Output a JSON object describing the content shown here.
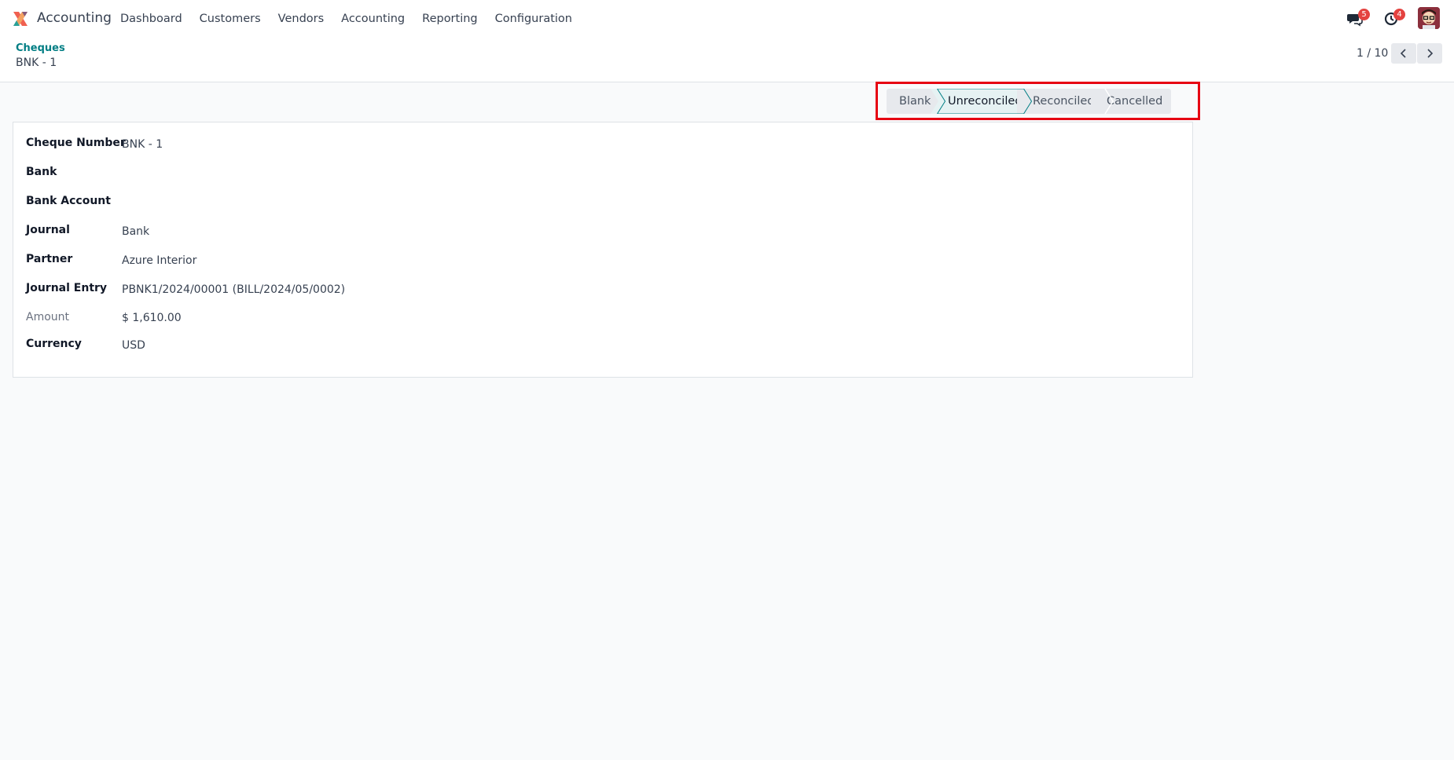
{
  "navbar": {
    "app_name": "Accounting",
    "menu": [
      "Dashboard",
      "Customers",
      "Vendors",
      "Accounting",
      "Reporting",
      "Configuration"
    ],
    "messages_count": "5",
    "activities_count": "4",
    "logo_icon": "odoo-accounting-logo",
    "badge_color": "#e4423f"
  },
  "breadcrumb": {
    "parent": "Cheques",
    "current": "BNK - 1"
  },
  "pager": {
    "value": "1 / 10"
  },
  "statusbar": {
    "stages": [
      "Blank",
      "Unreconciled",
      "Reconciled",
      "Cancelled"
    ],
    "active": "Unreconciled",
    "active_color": "#017e84"
  },
  "form": {
    "fields": [
      {
        "label": "Cheque Number",
        "value": "BNK - 1"
      },
      {
        "label": "Bank",
        "value": ""
      },
      {
        "label": "Bank Account",
        "value": ""
      },
      {
        "label": "Journal",
        "value": "Bank"
      },
      {
        "label": "Partner",
        "value": "Azure Interior"
      },
      {
        "label": "Journal Entry",
        "value": "PBNK1/2024/00001 (BILL/2024/05/0002)"
      },
      {
        "label": "Amount",
        "value": "$ 1,610.00"
      },
      {
        "label": "Currency",
        "value": "USD"
      }
    ]
  }
}
